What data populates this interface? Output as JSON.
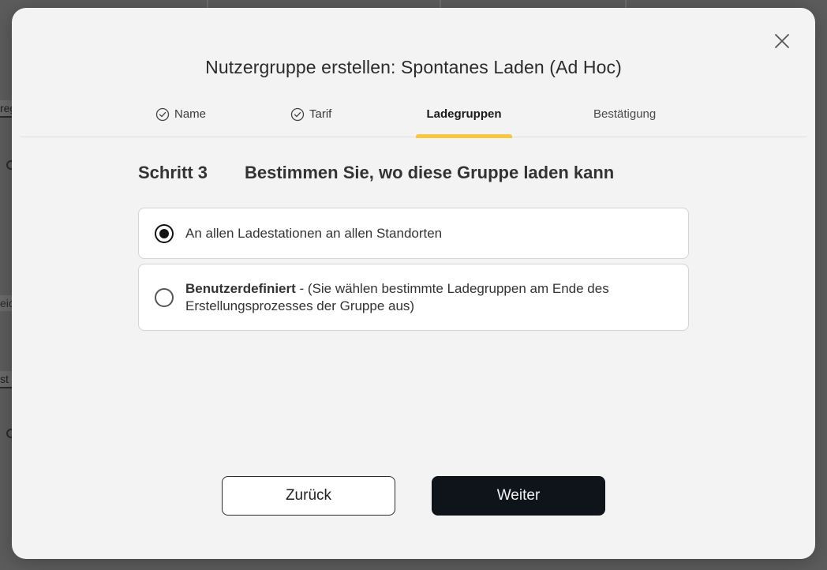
{
  "background": {
    "fragments": [
      "reg",
      "eic",
      "st"
    ]
  },
  "modal": {
    "title": "Nutzergruppe erstellen: Spontanes Laden (Ad Hoc)",
    "close_icon": "close-icon",
    "tabs": [
      {
        "label": "Name",
        "state": "done",
        "icon": "check-circle-icon"
      },
      {
        "label": "Tarif",
        "state": "done",
        "icon": "check-circle-icon"
      },
      {
        "label": "Ladegruppen",
        "state": "active"
      },
      {
        "label": "Bestätigung",
        "state": "pending"
      }
    ],
    "step": {
      "label": "Schritt 3",
      "heading": "Bestimmen Sie, wo diese Gruppe laden kann"
    },
    "options": [
      {
        "label": "An allen Ladestationen an allen Standorten",
        "selected": true
      },
      {
        "label_strong": "Benutzerdefiniert",
        "label_rest": " - (Sie wählen bestimmte Ladegruppen am Ende des Erstellungsprozesses der Gruppe aus)",
        "selected": false
      }
    ],
    "buttons": {
      "back": "Zurück",
      "next": "Weiter"
    }
  },
  "colors": {
    "accent": "#f5c842",
    "primary_button": "#0f141b",
    "modal_bg": "#f3f3f3"
  }
}
